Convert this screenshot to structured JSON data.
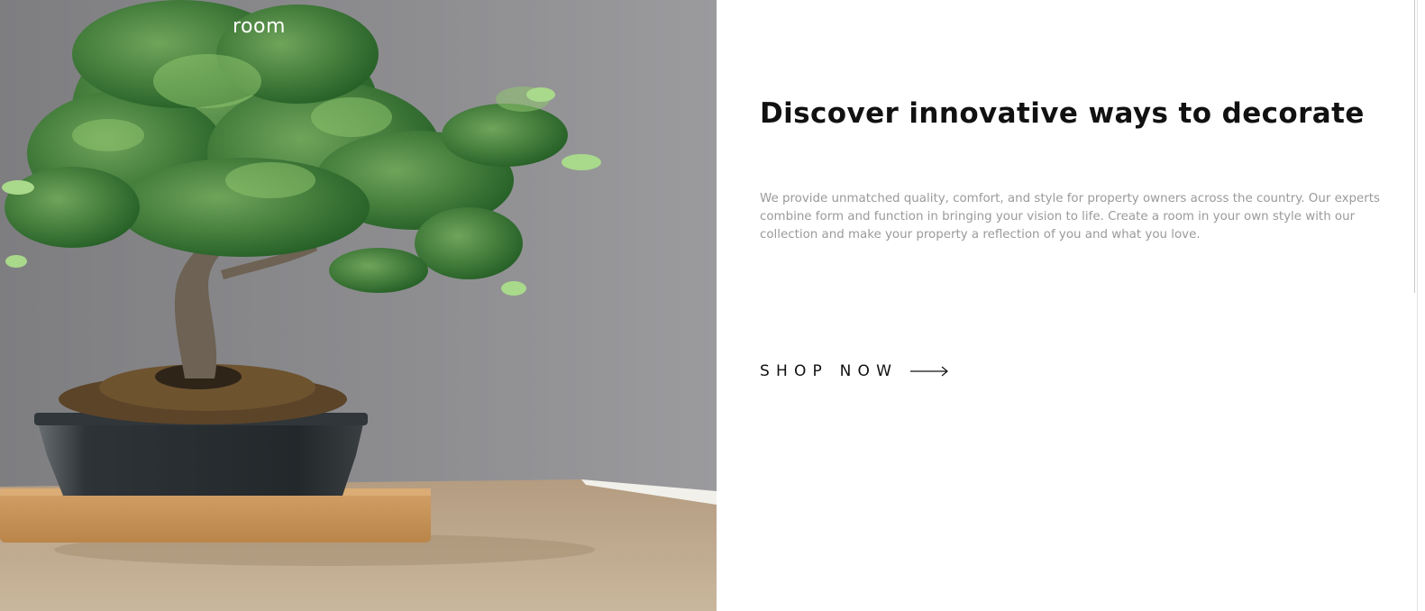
{
  "brand": {
    "logo_text": "room"
  },
  "hero": {
    "image_subject": "bonsai-tree-in-pot-on-wooden-table"
  },
  "main": {
    "headline": "Discover innovative ways to decorate",
    "description": "We provide unmatched quality, comfort, and style for property owners across the country. Our experts combine form and function in bringing your vision to life. Create a room in your own style with our collection and make your property a reflection of you and what you love.",
    "cta_label": "SHOP NOW",
    "cta_icon": "arrow-right-icon"
  },
  "colors": {
    "headline": "#111111",
    "description": "#9a9a9a",
    "background": "#ffffff"
  }
}
